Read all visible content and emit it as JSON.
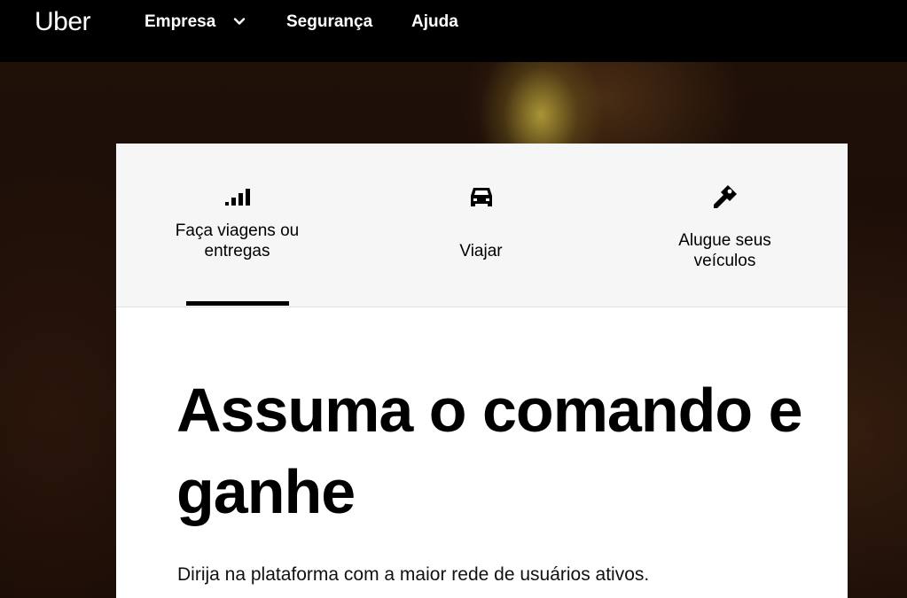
{
  "header": {
    "logo": "Uber",
    "nav": {
      "empresa": "Empresa",
      "seguranca": "Segurança",
      "ajuda": "Ajuda"
    },
    "chevron_icon": "chevron-down-icon"
  },
  "tabs": [
    {
      "label": "Faça viagens ou entregas",
      "icon": "signal-bars-icon",
      "selected": true
    },
    {
      "label": "Viajar",
      "icon": "car-icon",
      "selected": false
    },
    {
      "label": "Alugue seus veículos",
      "icon": "key-icon",
      "selected": false
    }
  ],
  "hero": {
    "headline": "Assuma o comando e ganhe",
    "subtext": "Dirija na plataforma com a maior rede de usuários ativos."
  },
  "colors": {
    "topbar": "#000000",
    "card": "#ffffff",
    "tab_strip": "#f6f6f6",
    "text": "#000000"
  }
}
